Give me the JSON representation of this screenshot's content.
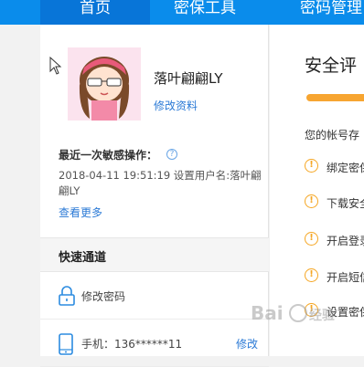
{
  "nav": {
    "tabs": [
      {
        "label": "首页",
        "active": true
      },
      {
        "label": "密保工具"
      },
      {
        "label": "密码管理"
      }
    ]
  },
  "profile": {
    "username": "落叶翩翩LY",
    "edit_link": "修改资料"
  },
  "sensitive": {
    "label": "最近一次敏感操作：",
    "help_icon": "question-circle-icon",
    "detail": "2018-04-11 19:51:19  设置用户名:落叶翩翩LY",
    "more_link": "查看更多"
  },
  "quick": {
    "title": "快速通道",
    "items": [
      {
        "label": "修改密码",
        "icon": "lock-icon"
      },
      {
        "label": "手机：136******11",
        "icon": "phone-icon",
        "action": "修改"
      }
    ]
  },
  "security": {
    "title": "安全评",
    "bar_color": "#f7a531",
    "account_text": "您的帐号存",
    "tips": [
      {
        "label": "绑定密保"
      },
      {
        "label": "下载安全"
      },
      {
        "label": "开启登录"
      },
      {
        "label": "开启短信"
      },
      {
        "label": "设置密保"
      }
    ]
  },
  "colors": {
    "nav_bg": "#0a8ceb",
    "nav_active": "#0875d8",
    "link": "#2b7ad6",
    "warning": "#f5a623"
  },
  "watermark": "Bai du 经验"
}
